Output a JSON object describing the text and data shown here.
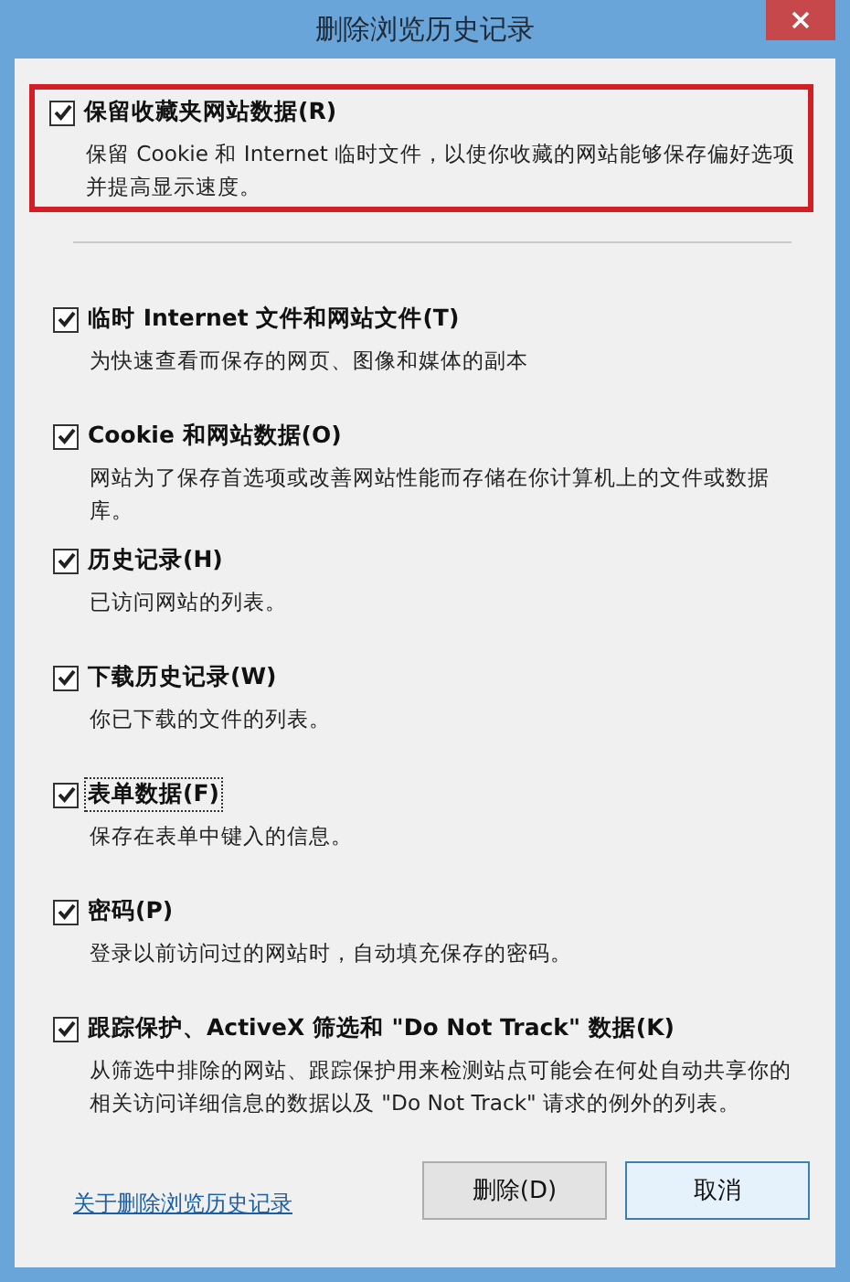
{
  "window": {
    "title": "删除浏览历史记录"
  },
  "options": [
    {
      "label": "保留收藏夹网站数据(R)",
      "description": "保留 Cookie 和 Internet 临时文件，以使你收藏的网站能够保存偏好选项并提高显示速度。",
      "checked": true,
      "highlighted": true,
      "focused": false
    },
    {
      "label": "临时 Internet 文件和网站文件(T)",
      "description": "为快速查看而保存的网页、图像和媒体的副本",
      "checked": true,
      "highlighted": false,
      "focused": false
    },
    {
      "label": "Cookie 和网站数据(O)",
      "description": "网站为了保存首选项或改善网站性能而存储在你计算机上的文件或数据库。",
      "checked": true,
      "highlighted": false,
      "focused": false
    },
    {
      "label": "历史记录(H)",
      "description": "已访问网站的列表。",
      "checked": true,
      "highlighted": false,
      "focused": false
    },
    {
      "label": "下载历史记录(W)",
      "description": "你已下载的文件的列表。",
      "checked": true,
      "highlighted": false,
      "focused": false
    },
    {
      "label": "表单数据(F)",
      "description": "保存在表单中键入的信息。",
      "checked": true,
      "highlighted": false,
      "focused": true
    },
    {
      "label": "密码(P)",
      "description": "登录以前访问过的网站时，自动填充保存的密码。",
      "checked": true,
      "highlighted": false,
      "focused": false
    },
    {
      "label": "跟踪保护、ActiveX 筛选和 \"Do Not Track\" 数据(K)",
      "description": "从筛选中排除的网站、跟踪保护用来检测站点可能会在何处自动共享你的相关访问详细信息的数据以及 \"Do Not Track\" 请求的例外的列表。",
      "checked": true,
      "highlighted": false,
      "focused": false
    }
  ],
  "footer": {
    "link": "关于删除浏览历史记录",
    "buttons": [
      "删除(D)",
      "取消"
    ]
  }
}
